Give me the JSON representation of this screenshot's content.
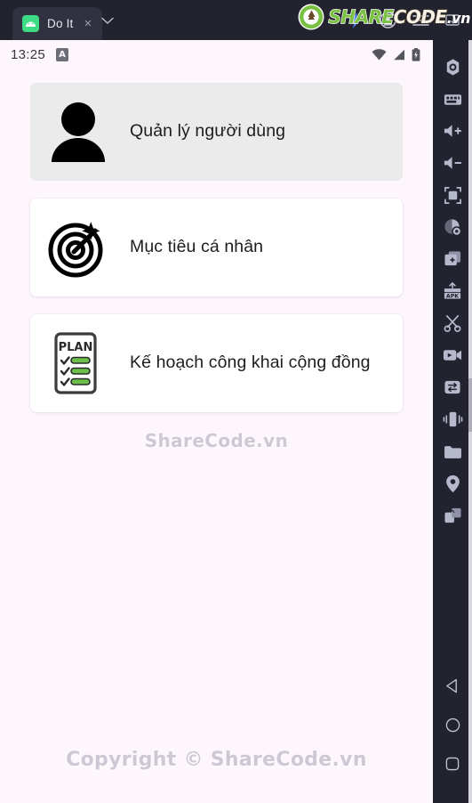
{
  "window": {
    "tab": {
      "label": "Do It",
      "icon": "android-icon",
      "close": "×",
      "chevron": "⌄"
    },
    "tools": [
      {
        "name": "lightning-icon",
        "badge": true
      },
      {
        "name": "account-circle-icon",
        "badge": false
      },
      {
        "name": "hamburger-menu-icon",
        "badge": false
      },
      {
        "name": "screenshot-icon",
        "badge": false
      }
    ],
    "logo": {
      "share": "SHARE",
      "code": "CODE",
      "tld": ".vn"
    }
  },
  "statusbar": {
    "time": "13:25",
    "app_badge": "A",
    "icons": [
      "wifi-icon",
      "signal-icon",
      "battery-charging-icon"
    ]
  },
  "main": {
    "cards": [
      {
        "label": "Quản lý người dùng",
        "icon": "person-icon",
        "style": "gray"
      },
      {
        "label": "Mục tiêu cá nhân",
        "icon": "target-icon",
        "style": "white"
      },
      {
        "label": "Kế hoạch công khai cộng đồng",
        "icon": "plan-clipboard-icon",
        "style": "white"
      }
    ],
    "watermark_middle": "ShareCode.vn",
    "footer": "Copyright © ShareCode.vn"
  },
  "sidebar": {
    "tools": [
      {
        "name": "settings-gear-icon"
      },
      {
        "name": "keyboard-mapping-icon"
      },
      {
        "name": "volume-up-icon"
      },
      {
        "name": "volume-down-icon"
      },
      {
        "name": "fullscreen-icon"
      },
      {
        "name": "screen-record-icon"
      },
      {
        "name": "multi-instance-icon"
      },
      {
        "name": "install-apk-icon"
      },
      {
        "name": "scissors-icon"
      },
      {
        "name": "video-record-icon"
      },
      {
        "name": "file-transfer-icon"
      },
      {
        "name": "shake-device-icon"
      },
      {
        "name": "folder-icon"
      },
      {
        "name": "location-pin-icon"
      },
      {
        "name": "rotate-screen-icon"
      }
    ],
    "nav": [
      {
        "name": "android-back-icon"
      },
      {
        "name": "android-home-icon"
      },
      {
        "name": "android-recents-icon"
      }
    ]
  },
  "colors": {
    "screen_bg": "#fdf6fd",
    "chrome_bg": "#22232f",
    "card_gray": "#ebebeb",
    "card_white": "#ffffff",
    "accent_green": "#7ac143",
    "android_green": "#3ddc84",
    "text_dark": "#1d1d1f",
    "watermark": "#cdc9d4"
  }
}
